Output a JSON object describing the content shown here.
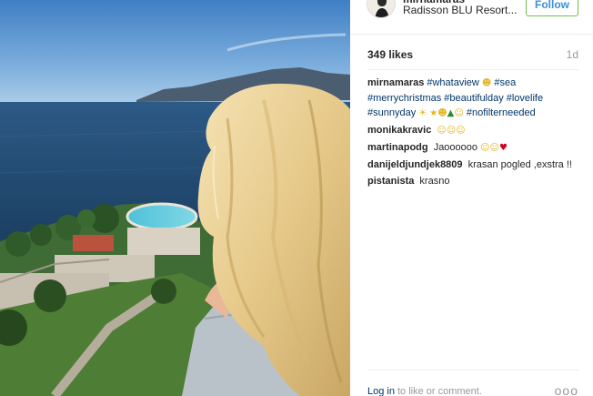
{
  "header": {
    "username": "mirnamaras",
    "location": "Radisson BLU Resort...",
    "follow_label": "Follow"
  },
  "stats": {
    "likes": "349 likes",
    "time": "1d"
  },
  "caption": {
    "user": "mirnamaras",
    "tags": [
      "#whataview",
      "#sea",
      "#merrychristmas",
      "#beautifulday",
      "#lovelife",
      "#sunnyday",
      "#nofilterneeded"
    ]
  },
  "comments": [
    {
      "user": "monikakravic",
      "text": ""
    },
    {
      "user": "martinapodg",
      "text": "Jaoooooo"
    },
    {
      "user": "danijeldjundjek8809",
      "text": "krasan pogled ,exstra !!"
    },
    {
      "user": "pistanista",
      "text": "krasno"
    }
  ],
  "footer": {
    "login_link": "Log in",
    "login_text": "to like or comment.",
    "more": "ooo"
  },
  "icons": {
    "avatar": "profile-avatar",
    "more": "more-options-icon"
  }
}
